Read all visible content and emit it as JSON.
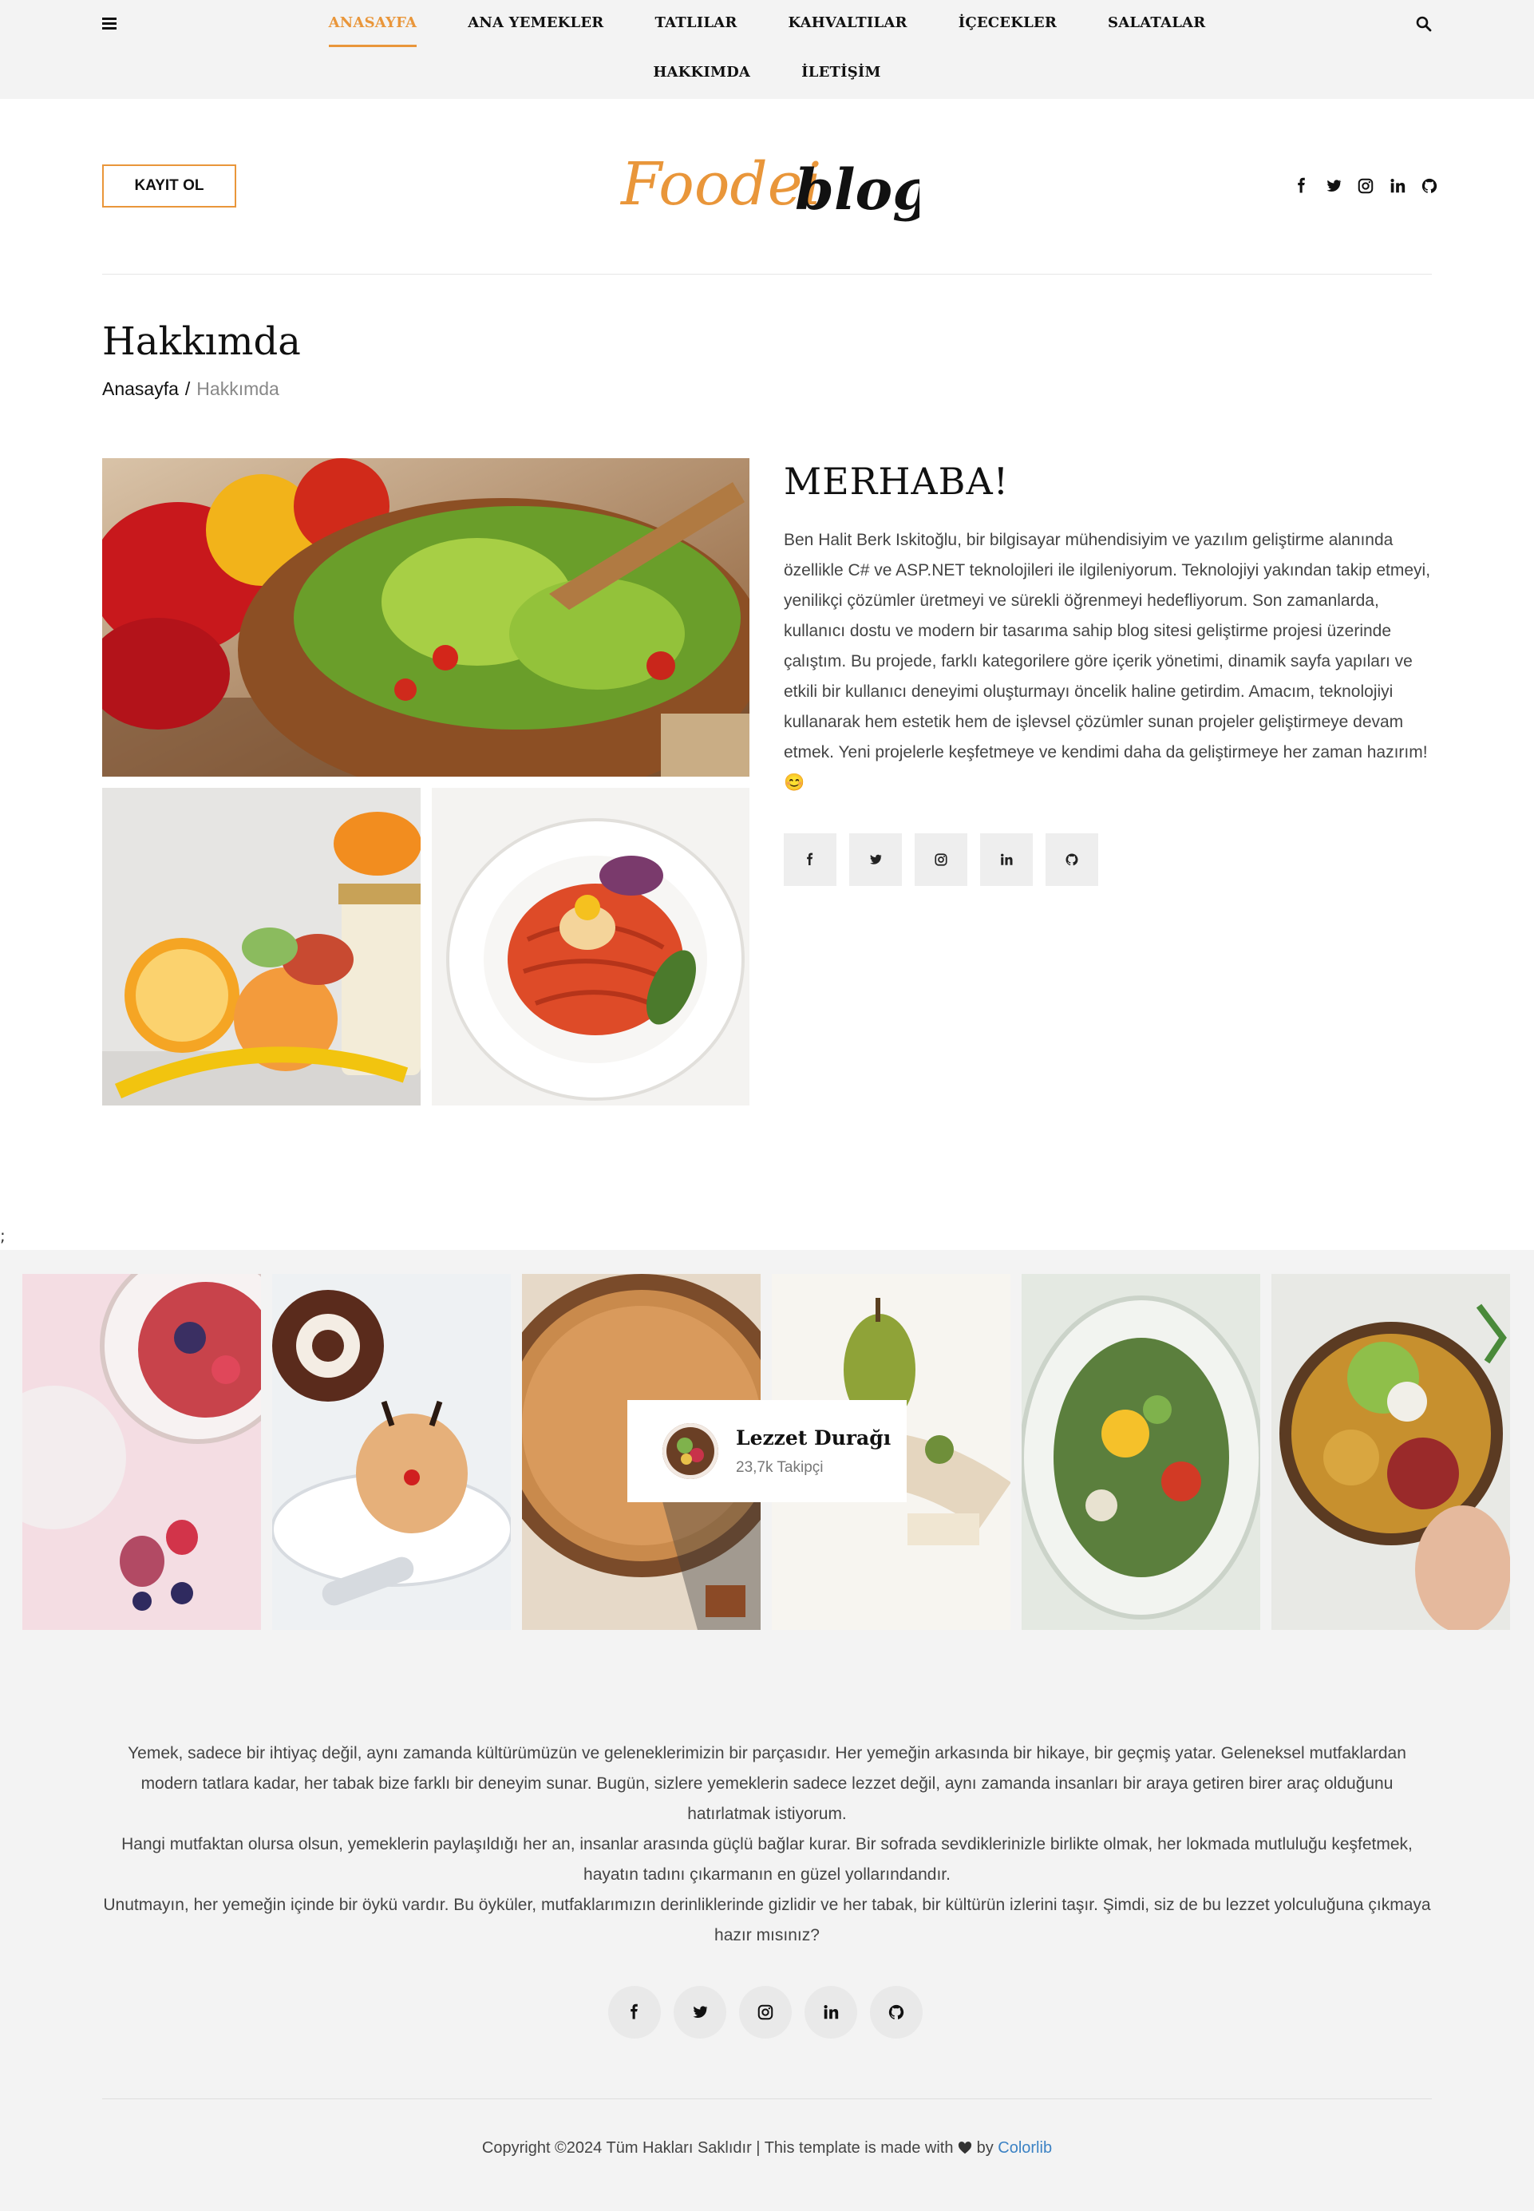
{
  "nav": {
    "row1": [
      "ANASAYFA",
      "ANA YEMEKLER",
      "TATLILAR",
      "KAHVALTILAR",
      "İÇECEKLER",
      "SALATALAR"
    ],
    "row2": [
      "HAKKIMDA",
      "İLETİŞİM"
    ],
    "active": "ANASAYFA"
  },
  "header": {
    "signup_label": "KAYIT OL",
    "logo_part1": "Foodei",
    "logo_part2": "blog",
    "social_icons": [
      "facebook-icon",
      "twitter-icon",
      "instagram-icon",
      "linkedin-icon",
      "github-icon"
    ]
  },
  "page": {
    "title": "Hakkımda",
    "breadcrumb_home": "Anasayfa",
    "breadcrumb_sep": "/",
    "breadcrumb_current": "Hakkımda"
  },
  "about": {
    "heading": "MERHABA!",
    "text": "Ben Halit Berk Iskitoğlu, bir bilgisayar mühendisiyim ve yazılım geliştirme alanında özellikle C# ve ASP.NET teknolojileri ile ilgileniyorum. Teknolojiyi yakından takip etmeyi, yenilikçi çözümler üretmeyi ve sürekli öğrenmeyi hedefliyorum. Son zamanlarda, kullanıcı dostu ve modern bir tasarıma sahip blog sitesi geliştirme projesi üzerinde çalıştım. Bu projede, farklı kategorilere göre içerik yönetimi, dinamik sayfa yapıları ve etkili bir kullanıcı deneyimi oluşturmayı öncelik haline getirdim. Amacım, teknolojiyi kullanarak hem estetik hem de işlevsel çözümler sunan projeler geliştirmeye devam etmek. Yeni projelerle keşfetmeye ve kendimi daha da geliştirmeye her zaman hazırım! 😊"
  },
  "stray_text": ";",
  "instagram": {
    "name": "Lezzet Durağı",
    "followers": "23,7k Takipçi"
  },
  "footer": {
    "p1": "Yemek, sadece bir ihtiyaç değil, aynı zamanda kültürümüzün ve geleneklerimizin bir parçasıdır. Her yemeğin arkasında bir hikaye, bir geçmiş yatar. Geleneksel mutfaklardan modern tatlara kadar, her tabak bize farklı bir deneyim sunar. Bugün, sizlere yemeklerin sadece lezzet değil, aynı zamanda insanları bir araya getiren birer araç olduğunu hatırlatmak istiyorum.",
    "p2": "Hangi mutfaktan olursa olsun, yemeklerin paylaşıldığı her an, insanlar arasında güçlü bağlar kurar. Bir sofrada sevdiklerinizle birlikte olmak, her lokmada mutluluğu keşfetmek, hayatın tadını çıkarmanın en güzel yollarındandır.",
    "p3": "Unutmayın, her yemeğin içinde bir öykü vardır. Bu öyküler, mutfaklarımızın derinliklerinde gizlidir ve her tabak, bir kültürün izlerini taşır. Şimdi, siz de bu lezzet yolculuğuna çıkmaya hazır mısınız?",
    "copyright_pre": "Copyright ©2024 Tüm Hakları Saklıdır | This template is made with",
    "copyright_by": "by",
    "copyright_link": "Colorlib"
  },
  "colors": {
    "accent": "#e9963a",
    "link": "#3b82c4"
  }
}
